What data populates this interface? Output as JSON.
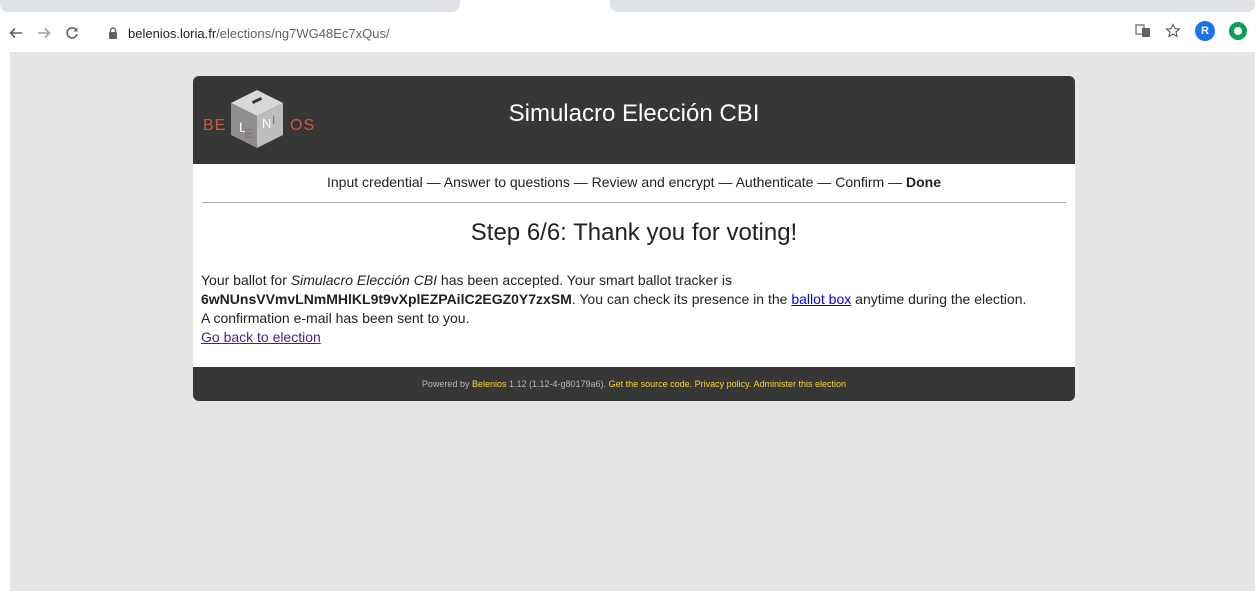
{
  "browser": {
    "url_domain": "belenios.loria.fr",
    "url_path": "/elections/ng7WG48Ec7xQus/",
    "avatar_letter": "R",
    "icons": [
      "back-arrow-icon",
      "forward-arrow-icon",
      "reload-icon",
      "lock-icon",
      "translate-icon",
      "star-icon",
      "profile-avatar",
      "extension-icon"
    ]
  },
  "header": {
    "logo_left": "BE",
    "logo_right": "OS",
    "election_title": "Simulacro Elección CBI"
  },
  "steps": {
    "s1": "Input credential",
    "s2": "Answer to questions",
    "s3": "Review and encrypt",
    "s4": "Authenticate",
    "s5": "Confirm",
    "s6": "Done",
    "sep": " — "
  },
  "main": {
    "step_title": "Step 6/6: Thank you for voting!",
    "p1_a": "Your ballot for ",
    "p1_election": "Simulacro Elección CBI",
    "p1_b": " has been accepted. Your smart ballot tracker is",
    "tracker": "6wNUnsVVmvLNmMHlKL9t9vXplEZPAilC2EGZ0Y7zxSM",
    "p1_c": ". You can check its presence in the ",
    "ballot_box_link": "ballot box",
    "p1_d": " anytime during the election.",
    "confirmation": "A confirmation e-mail has been sent to you.",
    "go_back_link": "Go back to election"
  },
  "footer": {
    "powered_by": "Powered by ",
    "belenios": "Belenios",
    "version": " 1.12 (1.12-4-g80179a6). ",
    "source_code": "Get the source code",
    "privacy": "Privacy policy",
    "administer": "Administer this election"
  },
  "colors": {
    "header_bg": "#373737",
    "page_bg": "#e6e5e3",
    "footer_link": "#ffd43b",
    "logo_text": "#d1573a"
  }
}
